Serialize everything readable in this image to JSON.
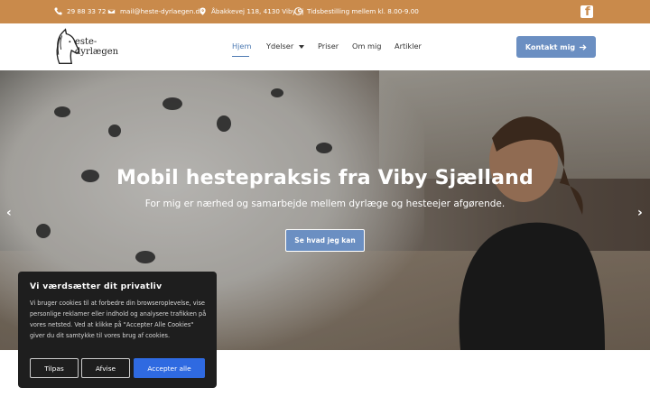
{
  "topbar": {
    "phone": "29 88 33 72",
    "email": "mail@heste-dyrlaegen.dk",
    "address": "Åbakkevej 118, 4130 Viby Sj",
    "hours": "Tidsbestilling mellem kl. 8.00-9.00",
    "icons": [
      "phone-icon",
      "envelope-icon",
      "map-pin-icon",
      "clock-icon",
      "facebook-icon"
    ],
    "background": "#c98a4b"
  },
  "header": {
    "logo_text": "este-dyrlægen",
    "nav": [
      {
        "label": "Hjem",
        "active": true
      },
      {
        "label": "Ydelser"
      },
      {
        "label": "Priser"
      },
      {
        "label": "Om mig"
      },
      {
        "label": "Artikler"
      }
    ],
    "contact_label": "Kontakt mig",
    "accent": "#6b8fc2"
  },
  "hero": {
    "title": "Mobil hestepraksis fra Viby Sjælland",
    "subtitle": "For mig er nærhed og samarbejde mellem dyrlæge og hesteejer afgørende.",
    "button_label": "Se hvad jeg kan",
    "prev_arrow": "‹",
    "next_arrow": "›"
  },
  "cookie": {
    "title": "Vi værdsætter dit privatliv",
    "body": "Vi bruger cookies til at forbedre din browseroplevelse, vise personlige reklamer eller indhold og analysere trafikken på vores netsted. Ved at klikke på \"Accepter Alle Cookies\" giver du dit samtykke til vores brug af cookies.",
    "customize_label": "Tilpas",
    "reject_label": "Afvise",
    "accept_label": "Accepter alle",
    "accept_color": "#2f6ae1"
  }
}
